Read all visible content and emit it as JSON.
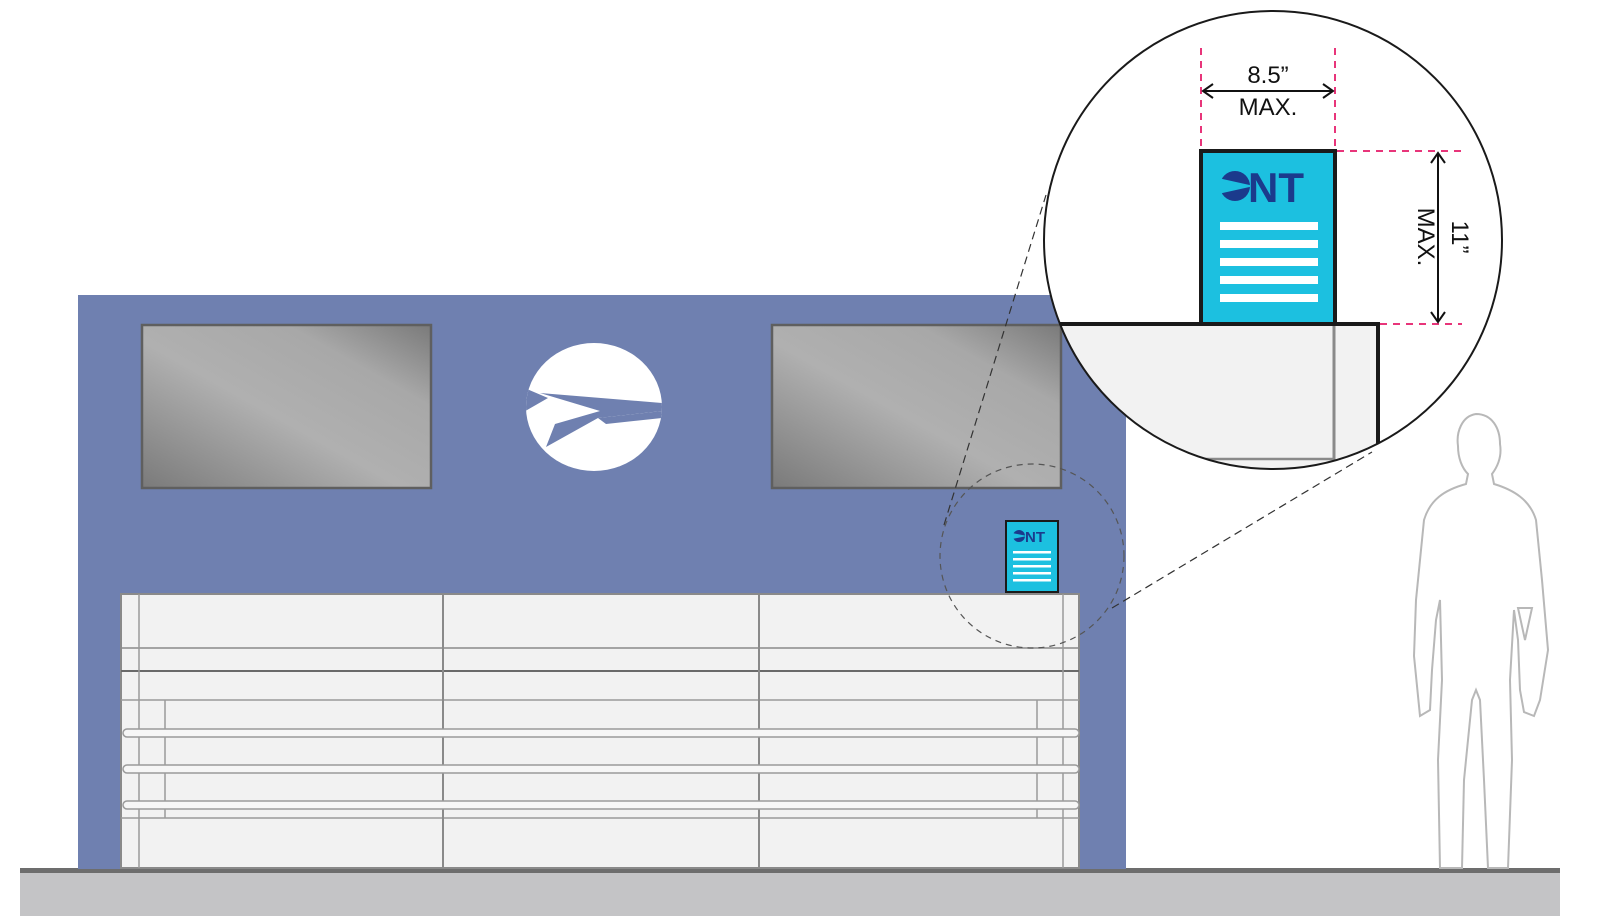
{
  "colors": {
    "wall": "#6f80b0",
    "counter": "#f2f2f2",
    "counter_line": "#8a8a8a",
    "screen_dark": "#7a7a7a",
    "screen_light": "#b0b0b0",
    "sign_fill": "#1cc0e0",
    "sign_logo": "#1b3a8c",
    "dimension_pink": "#e8357a",
    "floor": "#c4c4c6",
    "floor_line": "#6d6d6d",
    "person_outline": "#b8b8b8"
  },
  "icons": {
    "wall_logo": "airplane-circle-icon",
    "sign_logo": "ont-logo-icon"
  },
  "sign": {
    "logo_text": "NT",
    "logo_text_small": "NT"
  },
  "dimensions": {
    "width_value": "8.5”",
    "width_label": "MAX.",
    "height_value": "11”",
    "height_label": "MAX."
  }
}
